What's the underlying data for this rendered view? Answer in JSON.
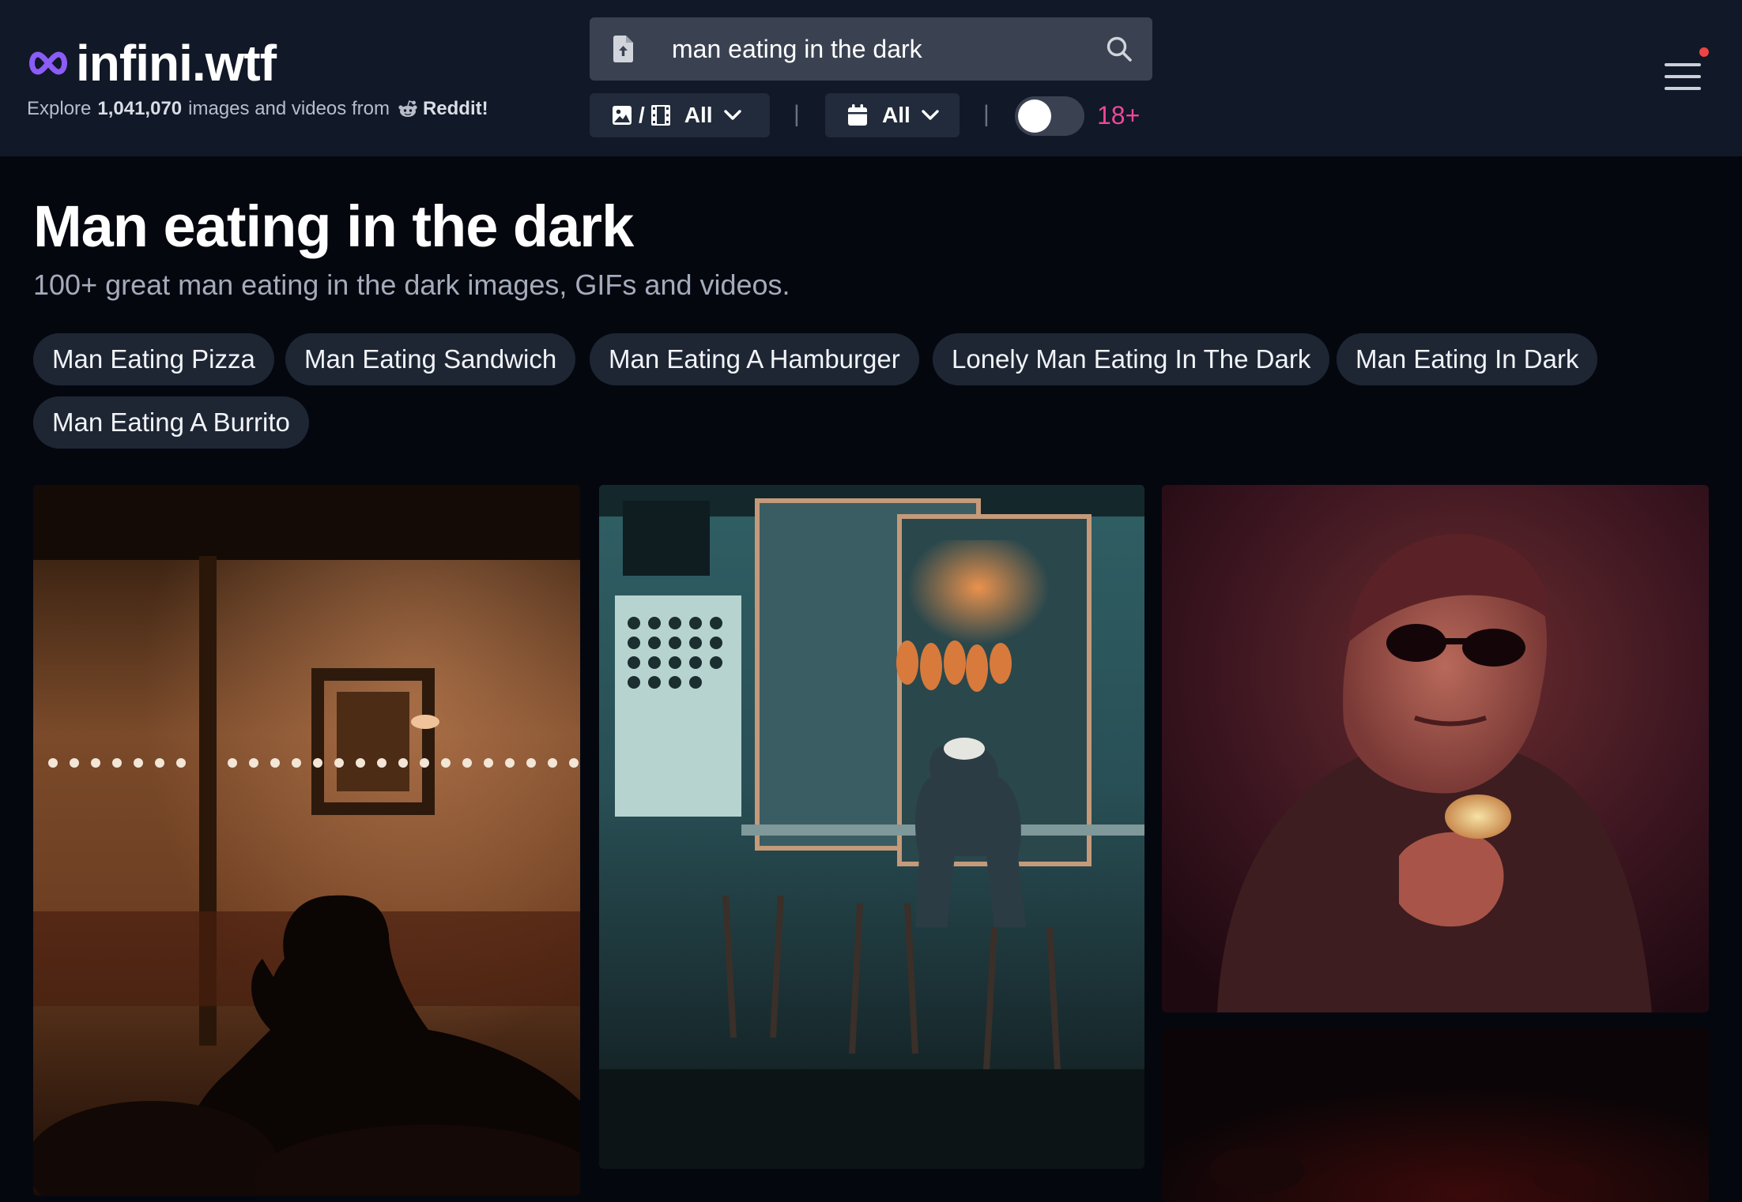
{
  "header": {
    "logo_text": "infini.wtf",
    "tagline_prefix": "Explore",
    "tagline_count": "1,041,070",
    "tagline_middle": "images and videos from",
    "tagline_source": "Reddit",
    "tagline_suffix": "!"
  },
  "search": {
    "value": "man eating in the dark",
    "placeholder": "Search"
  },
  "filters": {
    "media_type": {
      "separator": "/",
      "value": "All"
    },
    "date_range": {
      "value": "All"
    },
    "pipe": "|",
    "nsfw_toggle": {
      "on": false,
      "label": "18+"
    }
  },
  "colors": {
    "accent_logo": "#8b5cf6",
    "nsfw_label": "#ec4899",
    "notification": "#ef4444",
    "header_bg": "#111827",
    "page_bg": "#05070f"
  },
  "main": {
    "title": "Man eating in the dark",
    "subtitle": "100+ great man eating in the dark images, GIFs and videos.",
    "related_tags": [
      "Man Eating Pizza",
      "Man Eating Sandwich",
      "Man Eating A Hamburger",
      "Lonely Man Eating In The Dark",
      "Man Eating In Dark",
      "Man Eating A Burrito"
    ]
  },
  "icons": {
    "logo": "infinity-icon",
    "search_mode": "file-upload-icon",
    "search": "search-icon",
    "media_image": "image-icon",
    "media_video": "film-icon",
    "dropdown": "chevron-down-icon",
    "calendar": "calendar-icon",
    "menu": "hamburger-menu-icon",
    "reddit": "reddit-icon"
  }
}
